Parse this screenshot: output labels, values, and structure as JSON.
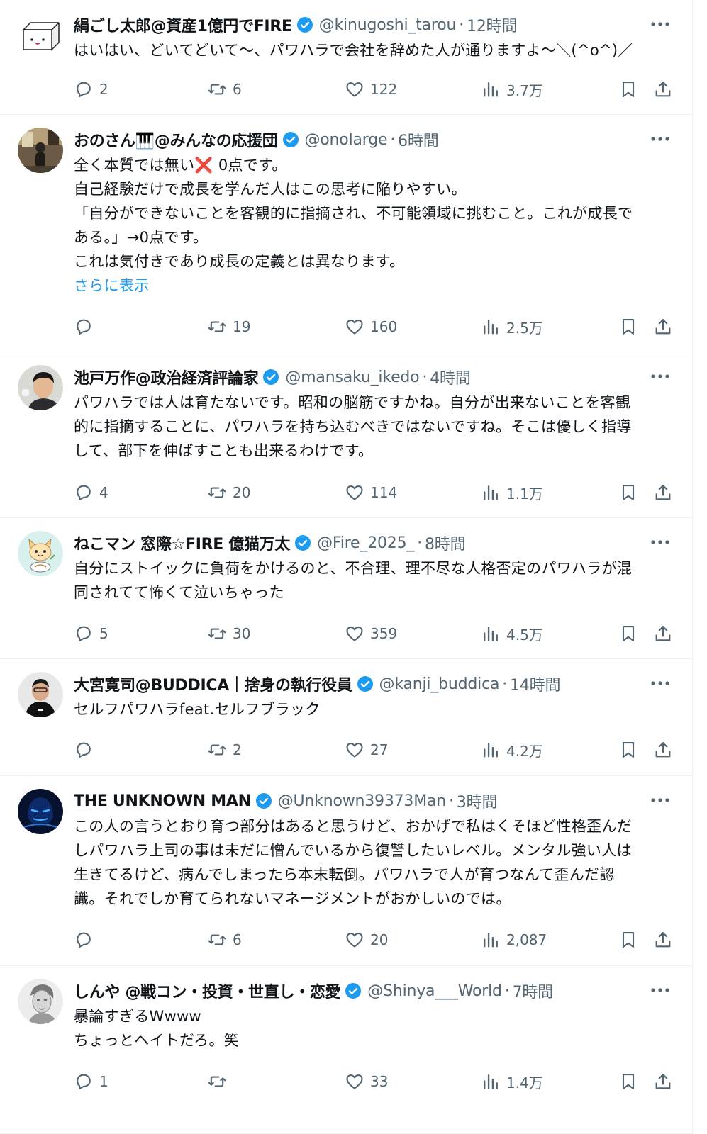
{
  "colors": {
    "text": "#0f1419",
    "secondary": "#536471",
    "accent": "#1d9bf0",
    "divider": "#eff3f4"
  },
  "tweets": [
    {
      "name": "絹ごし太郎@資産1億円でFIRE",
      "handle": "@kinugoshi_tarou",
      "time": "12時間",
      "lines": [
        "はいはい、どいてどいて〜、パワハラで会社を辞めた人が通りますよ〜＼(^o^)／"
      ],
      "show_more": "",
      "replies": "2",
      "retweets": "6",
      "likes": "122",
      "views": "3.7万"
    },
    {
      "name": "おのさん🎹@みんなの応援団",
      "handle": "@onolarge",
      "time": "6時間",
      "lines": [
        "全く本質では無い❌ 0点です。",
        "自己経験だけで成長を学んだ人はこの思考に陥りやすい。",
        "「自分ができないことを客観的に指摘され、不可能領域に挑むこと。これが成長で",
        "ある。」→0点です。",
        "これは気付きであり成長の定義とは異なります。"
      ],
      "show_more": "さらに表示",
      "replies": "",
      "retweets": "19",
      "likes": "160",
      "views": "2.5万"
    },
    {
      "name": "池戸万作@政治経済評論家",
      "handle": "@mansaku_ikedo",
      "time": "4時間",
      "lines": [
        "パワハラでは人は育たないです。昭和の脳筋ですかね。自分が出来ないことを客観",
        "的に指摘することに、パワハラを持ち込むべきではないですね。そこは優しく指導",
        "して、部下を伸ばすことも出来るわけです。"
      ],
      "show_more": "",
      "replies": "4",
      "retweets": "20",
      "likes": "114",
      "views": "1.1万"
    },
    {
      "name": "ねこマン 窓際☆FIRE 億猫万太",
      "handle": "@Fire_2025_",
      "time": "8時間",
      "lines": [
        "自分にストイックに負荷をかけるのと、不合理、理不尽な人格否定のパワハラが混",
        "同されてて怖くて泣いちゃった"
      ],
      "show_more": "",
      "replies": "5",
      "retweets": "30",
      "likes": "359",
      "views": "4.5万"
    },
    {
      "name": "大宮寛司@BUDDICA｜捨身の執行役員",
      "handle": "@kanji_buddica",
      "time": "14時間",
      "lines": [
        "セルフパワハラfeat.セルフブラック"
      ],
      "show_more": "",
      "replies": "",
      "retweets": "2",
      "likes": "27",
      "views": "4.2万"
    },
    {
      "name": "THE UNKNOWN MAN",
      "handle": "@Unknown39373Man",
      "time": "3時間",
      "lines": [
        "この人の言うとおり育つ部分はあると思うけど、おかげで私はくそほど性格歪んだ",
        "しパワハラ上司の事は未だに憎んでいるから復讐したいレベル。メンタル強い人は",
        "生きてるけど、病んでしまったら本末転倒。パワハラで人が育つなんて歪んだ認",
        "識。それでしか育てられないマネージメントがおかしいのでは。"
      ],
      "show_more": "",
      "replies": "",
      "retweets": "6",
      "likes": "20",
      "views": "2,087"
    },
    {
      "name": "しんや @戦コン・投資・世直し・恋愛",
      "handle": "@Shinya___World",
      "time": "7時間",
      "lines": [
        "暴論すぎるWwww",
        "ちょっとヘイトだろ。笑"
      ],
      "show_more": "",
      "replies": "1",
      "retweets": "",
      "likes": "33",
      "views": "1.4万"
    }
  ]
}
